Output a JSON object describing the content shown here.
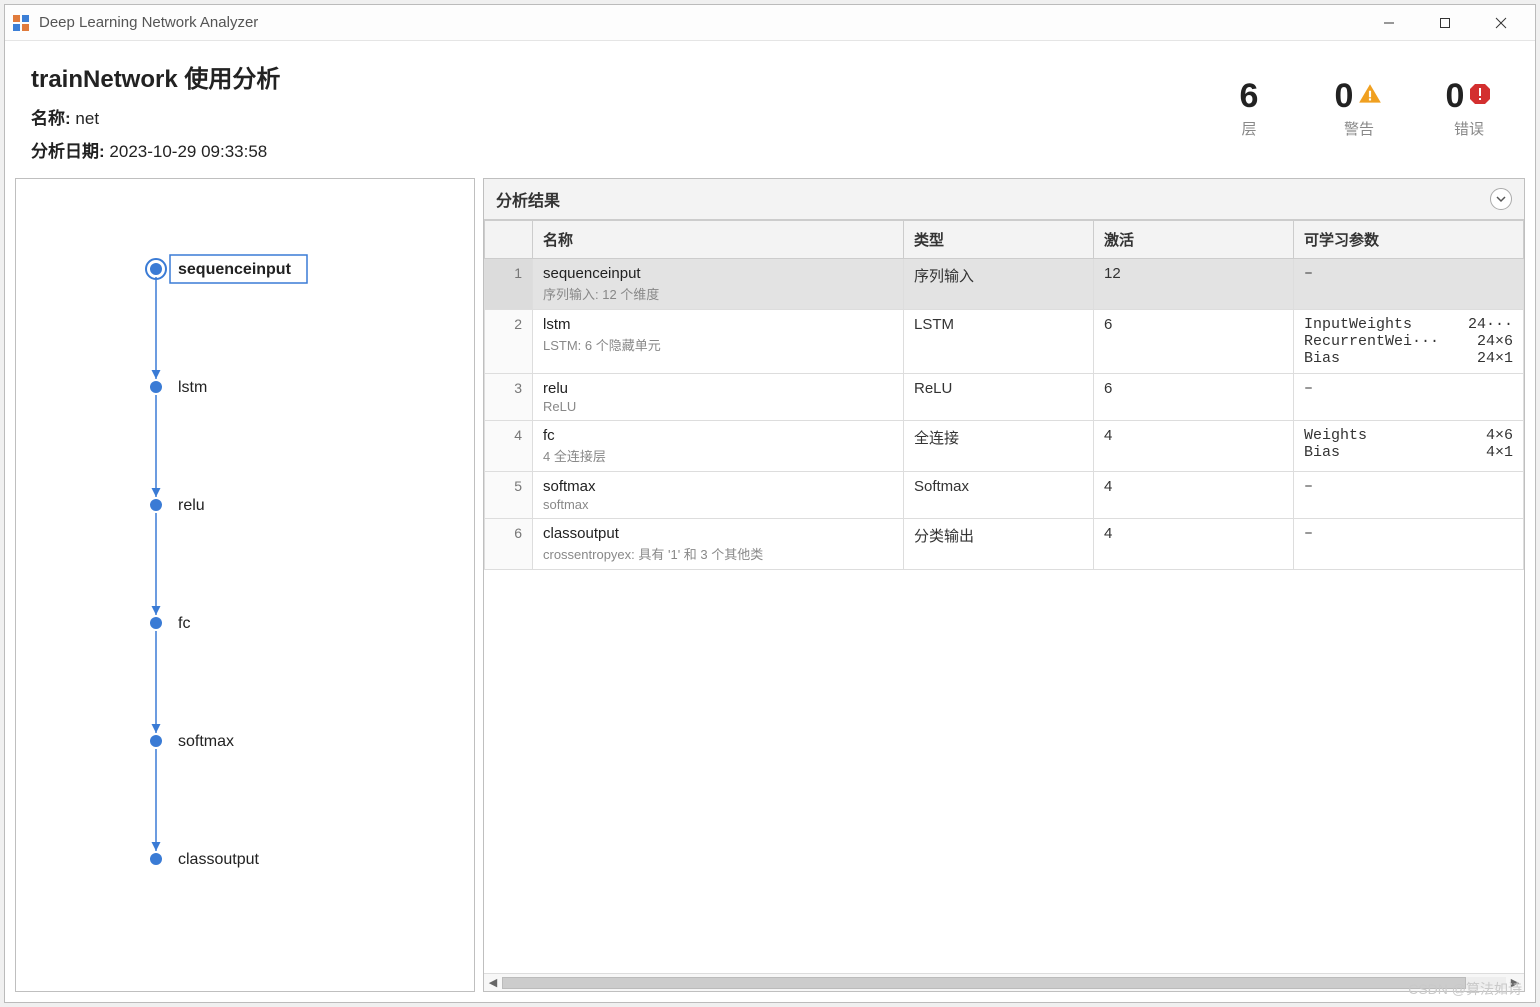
{
  "window": {
    "title": "Deep Learning Network Analyzer"
  },
  "header": {
    "title": "trainNetwork 使用分析",
    "name_label": "名称:",
    "name_value": "net",
    "date_label": "分析日期:",
    "date_value": "2023-10-29 09:33:58"
  },
  "stats": {
    "layers": {
      "value": "6",
      "label": "层"
    },
    "warnings": {
      "value": "0",
      "label": "警告"
    },
    "errors": {
      "value": "0",
      "label": "错误"
    }
  },
  "graph": {
    "nodes": [
      "sequenceinput",
      "lstm",
      "relu",
      "fc",
      "softmax",
      "classoutput"
    ],
    "selected": 0
  },
  "results": {
    "title": "分析结果",
    "columns": {
      "idx": "",
      "name": "名称",
      "type": "类型",
      "activations": "激活",
      "learnables": "可学习参数"
    },
    "rows": [
      {
        "idx": "1",
        "selected": true,
        "name": "sequenceinput",
        "desc": "序列输入: 12 个维度",
        "type": "序列输入",
        "activations": "12",
        "learnables": [
          {
            "n": "–",
            "d": ""
          }
        ]
      },
      {
        "idx": "2",
        "name": "lstm",
        "desc": "LSTM: 6 个隐藏单元",
        "type": "LSTM",
        "activations": "6",
        "learnables": [
          {
            "n": "InputWeights",
            "d": "24···"
          },
          {
            "n": "RecurrentWei···",
            "d": "24×6"
          },
          {
            "n": "Bias",
            "d": "24×1"
          }
        ]
      },
      {
        "idx": "3",
        "name": "relu",
        "desc": "ReLU",
        "type": "ReLU",
        "activations": "6",
        "learnables": [
          {
            "n": "–",
            "d": ""
          }
        ]
      },
      {
        "idx": "4",
        "name": "fc",
        "desc": "4 全连接层",
        "type": "全连接",
        "activations": "4",
        "learnables": [
          {
            "n": "Weights",
            "d": "4×6"
          },
          {
            "n": "Bias",
            "d": "4×1"
          }
        ]
      },
      {
        "idx": "5",
        "name": "softmax",
        "desc": "softmax",
        "type": "Softmax",
        "activations": "4",
        "learnables": [
          {
            "n": "–",
            "d": ""
          }
        ]
      },
      {
        "idx": "6",
        "name": "classoutput",
        "desc": "crossentropyex: 具有 '1' 和 3 个其他类",
        "type": "分类输出",
        "activations": "4",
        "learnables": [
          {
            "n": "–",
            "d": ""
          }
        ]
      }
    ]
  },
  "watermark": "CSDN @算法如诗"
}
